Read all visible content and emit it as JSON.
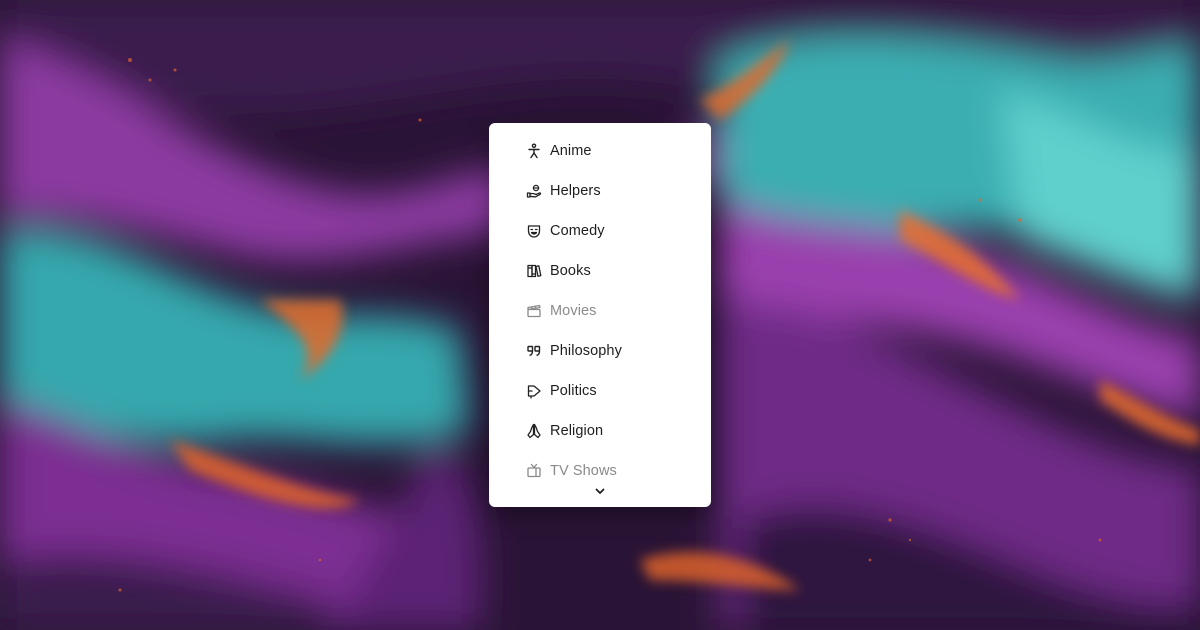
{
  "menu": {
    "items": [
      {
        "label": "Anime",
        "icon": "person-icon",
        "muted": false
      },
      {
        "label": "Helpers",
        "icon": "helping-hand-icon",
        "muted": false
      },
      {
        "label": "Comedy",
        "icon": "theater-mask-icon",
        "muted": false
      },
      {
        "label": "Books",
        "icon": "books-icon",
        "muted": false
      },
      {
        "label": "Movies",
        "icon": "clapperboard-icon",
        "muted": true
      },
      {
        "label": "Philosophy",
        "icon": "quote-icon",
        "muted": false
      },
      {
        "label": "Politics",
        "icon": "megaphone-icon",
        "muted": false
      },
      {
        "label": "Religion",
        "icon": "praying-hands-icon",
        "muted": false
      },
      {
        "label": "TV Shows",
        "icon": "tv-icon",
        "muted": true
      }
    ],
    "scroll_icon": "chevron-down-icon"
  },
  "colors": {
    "background_purple": "#7a2f8f",
    "background_teal": "#3fb7b9",
    "background_orange": "#e0642a",
    "background_dark": "#2a1436",
    "menu_bg": "#ffffff",
    "text": "#1e1e1e",
    "muted_text": "#8a8a8a"
  }
}
